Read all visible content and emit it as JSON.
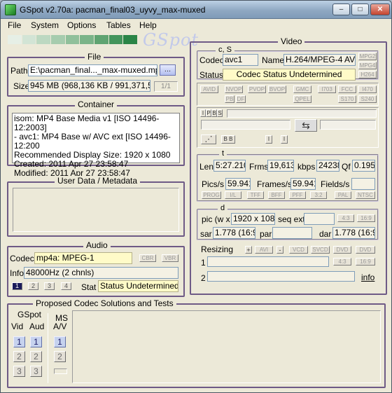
{
  "window": {
    "title": "GSpot v2.70a: pacman_final03_uyvy_max-muxed",
    "min": "–",
    "max": "□",
    "close": "✕"
  },
  "menu": [
    "File",
    "System",
    "Options",
    "Tables",
    "Help"
  ],
  "logo": "GSpot",
  "file": {
    "title": "File",
    "path_label": "Path",
    "path_value": "E:\\pacman_final..._max-muxed.mp4",
    "browse": "...",
    "size_label": "Size",
    "size_value": "945 MB (968,136 KB / 991,371,584",
    "page": "1/1"
  },
  "container": {
    "title": "Container",
    "lines": [
      "isom: MP4  Base Media v1 [ISO 14496-12:2003]",
      "- avc1: MP4 Base w/ AVC ext [ISO 14496-12:200",
      "Recommended Display Size: 1920 x 1080",
      "Created:     2011 Apr 27    23:58:47",
      "Modified:    2011 Apr 27    23:58:47"
    ]
  },
  "metadata": {
    "title": "User Data / Metadata"
  },
  "audio": {
    "title": "Audio",
    "codec_label": "Codec",
    "codec_value": "mp4a: MPEG-1",
    "cbr": "CBR",
    "vbr": "VBR",
    "info_label": "Info",
    "info_value": "48000Hz  (2 chnls)",
    "streams": [
      "1",
      "2",
      "3",
      "4"
    ],
    "stat_label": "Stat",
    "stat_value": "Status Undetermined"
  },
  "proposed": {
    "title": "Proposed Codec Solutions and Tests",
    "gspot": "GSpot",
    "vid": "Vid",
    "aud": "Aud",
    "ms": "MS",
    "av": "A/V",
    "nums": [
      "1",
      "2",
      "3"
    ]
  },
  "video": {
    "title": "Video",
    "cs_title": "c, S",
    "codec_label": "Codec",
    "codec_value": "avc1",
    "name_label": "Name",
    "name_value": "H.264/MPEG-4 AVC",
    "mpg_btns": [
      "MPG2",
      "MPG4",
      "H264"
    ],
    "status_label": "Status",
    "status_value": "Codec Status Undetermined",
    "row_btns1": [
      "AVID",
      "NVOP",
      "PVOP",
      "BVOP",
      "GMC",
      "I703",
      "FCC",
      "I470"
    ],
    "row_btns2": [
      "PB",
      "DF",
      "QPEL",
      "S170",
      "S240"
    ],
    "frame_btns": [
      "I",
      "P",
      "B",
      "S"
    ],
    "bb": "B B",
    "t_title": "t",
    "len_label": "Len",
    "len_value": "5:27.210",
    "frms_label": "Frms",
    "frms_value": "19,613",
    "kbps_label": "kbps",
    "kbps_value": "24238",
    "qf_label": "Qf",
    "qf_value": "0.195",
    "pics_label": "Pics/s",
    "pics_value": "59.941",
    "frames_label": "Frames/s",
    "frames_value": "59.941",
    "fields_label": "Fields/s",
    "t_btns": [
      "PROG",
      "I/L",
      "TFF",
      "BFF",
      "PFF",
      "3:2",
      "PAL",
      "NTSC"
    ],
    "d_title": "d",
    "pic_label": "pic (w x",
    "pic_value": "1920 x 1080",
    "seq_label": "seq ext",
    "ar43": "4:3",
    "ar169": "16:9",
    "sar_label": "sar",
    "sar_value": "1.778 (16:9)",
    "par_label": "par",
    "dar_label": "dar",
    "dar_value": "1.778 (16:9)",
    "resizing_label": "Resizing",
    "plus": "+",
    "avi": "AVI",
    "minus": "-",
    "resize_btns": [
      "VCD",
      "SVCD",
      "DVD",
      "DVD"
    ],
    "r1": "1",
    "r2": "2",
    "info_link": "info"
  }
}
